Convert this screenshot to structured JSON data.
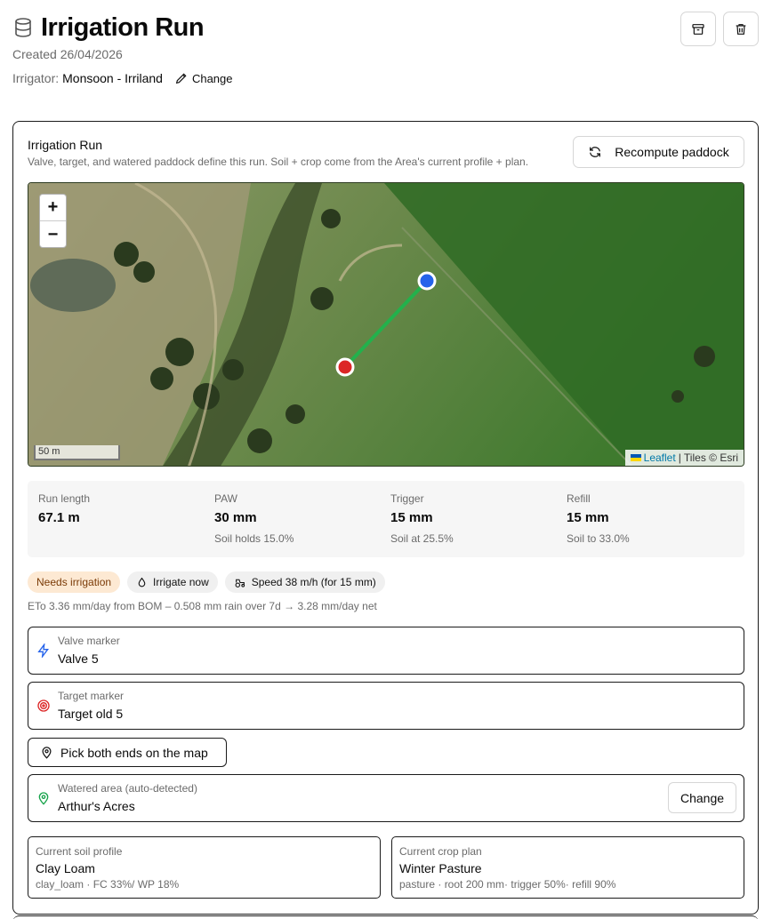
{
  "header": {
    "title": "Irrigation Run",
    "created": "Created 26/04/2026",
    "irrigator_label": "Irrigator:",
    "irrigator_value": "Monsoon - Irriland",
    "change_label": "Change"
  },
  "card": {
    "title": "Irrigation Run",
    "description": "Valve, target, and watered paddock define this run. Soil + crop come from the Area's current profile + plan.",
    "recompute_label": "Recompute paddock"
  },
  "map": {
    "zoom_in": "+",
    "zoom_out": "−",
    "scale": "50 m",
    "attribution_leaflet": "Leaflet",
    "attribution_tiles": "| Tiles © Esri",
    "valve_color": "#2563eb",
    "target_color": "#dc2626",
    "line_color": "#22b14c"
  },
  "stats": [
    {
      "label": "Run length",
      "value": "67.1 m",
      "sub": ""
    },
    {
      "label": "PAW",
      "value": "30 mm",
      "sub": "Soil holds 15.0%"
    },
    {
      "label": "Trigger",
      "value": "15 mm",
      "sub": "Soil at 25.5%"
    },
    {
      "label": "Refill",
      "value": "15 mm",
      "sub": "Soil to 33.0%"
    }
  ],
  "badges": {
    "needs": "Needs irrigation",
    "irrigate": "Irrigate now",
    "speed": "Speed 38 m/h (for 15 mm)"
  },
  "eto_text": "ETo 3.36 mm/day from BOM – 0.508 mm rain over 7d → 3.28 mm/day net",
  "valve": {
    "label": "Valve marker",
    "value": "Valve 5"
  },
  "target": {
    "label": "Target marker",
    "value": "Target old 5"
  },
  "pick_label": "Pick both ends on the map",
  "area": {
    "label": "Watered area (auto-detected)",
    "value": "Arthur's Acres",
    "change_label": "Change"
  },
  "soil": {
    "label": "Current soil profile",
    "value": "Clay Loam",
    "sub": "clay_loam · FC 33%/ WP 18%"
  },
  "crop": {
    "label": "Current crop plan",
    "value": "Winter Pasture",
    "sub": "pasture · root 200 mm· trigger 50%· refill 90%"
  }
}
